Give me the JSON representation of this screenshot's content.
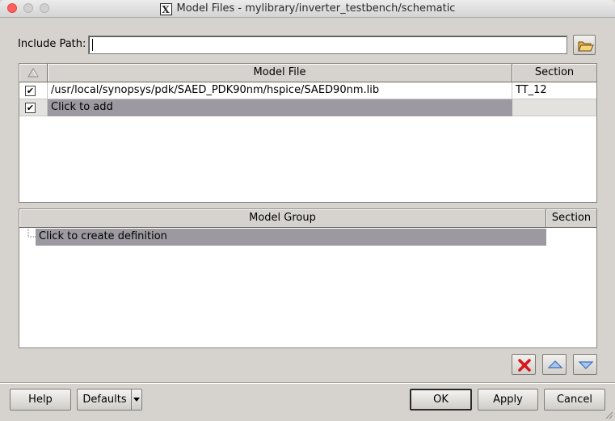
{
  "window": {
    "title": "Model Files - mylibrary/inverter_testbench/schematic",
    "x_badge": "X"
  },
  "include": {
    "label": "Include Path:",
    "value": "",
    "browse_icon": "folder-open-icon"
  },
  "model_table": {
    "sort_icon": "sort-triangle-icon",
    "columns": [
      "Model File",
      "Section"
    ],
    "rows": [
      {
        "checked": true,
        "file": "/usr/local/synopsys/pdk/SAED_PDK90nm/hspice/SAED90nm.lib",
        "section": "TT_12"
      },
      {
        "checked": true,
        "file": "Click to add",
        "section": ""
      }
    ]
  },
  "group_table": {
    "columns": [
      "Model Group",
      "Section"
    ],
    "rows": [
      {
        "label": "Click to create definition"
      }
    ]
  },
  "actions": {
    "delete_icon": "delete-x-icon",
    "up_icon": "move-up-icon",
    "down_icon": "move-down-icon"
  },
  "buttons": {
    "help": "Help",
    "defaults": "Defaults",
    "ok": "OK",
    "apply": "Apply",
    "cancel": "Cancel"
  },
  "colors": {
    "selected_row": "#9c9aa0",
    "header_bg": "#d6d3ce",
    "delete_red": "#d6161b",
    "arrow_blue": "#3b6fb6"
  }
}
